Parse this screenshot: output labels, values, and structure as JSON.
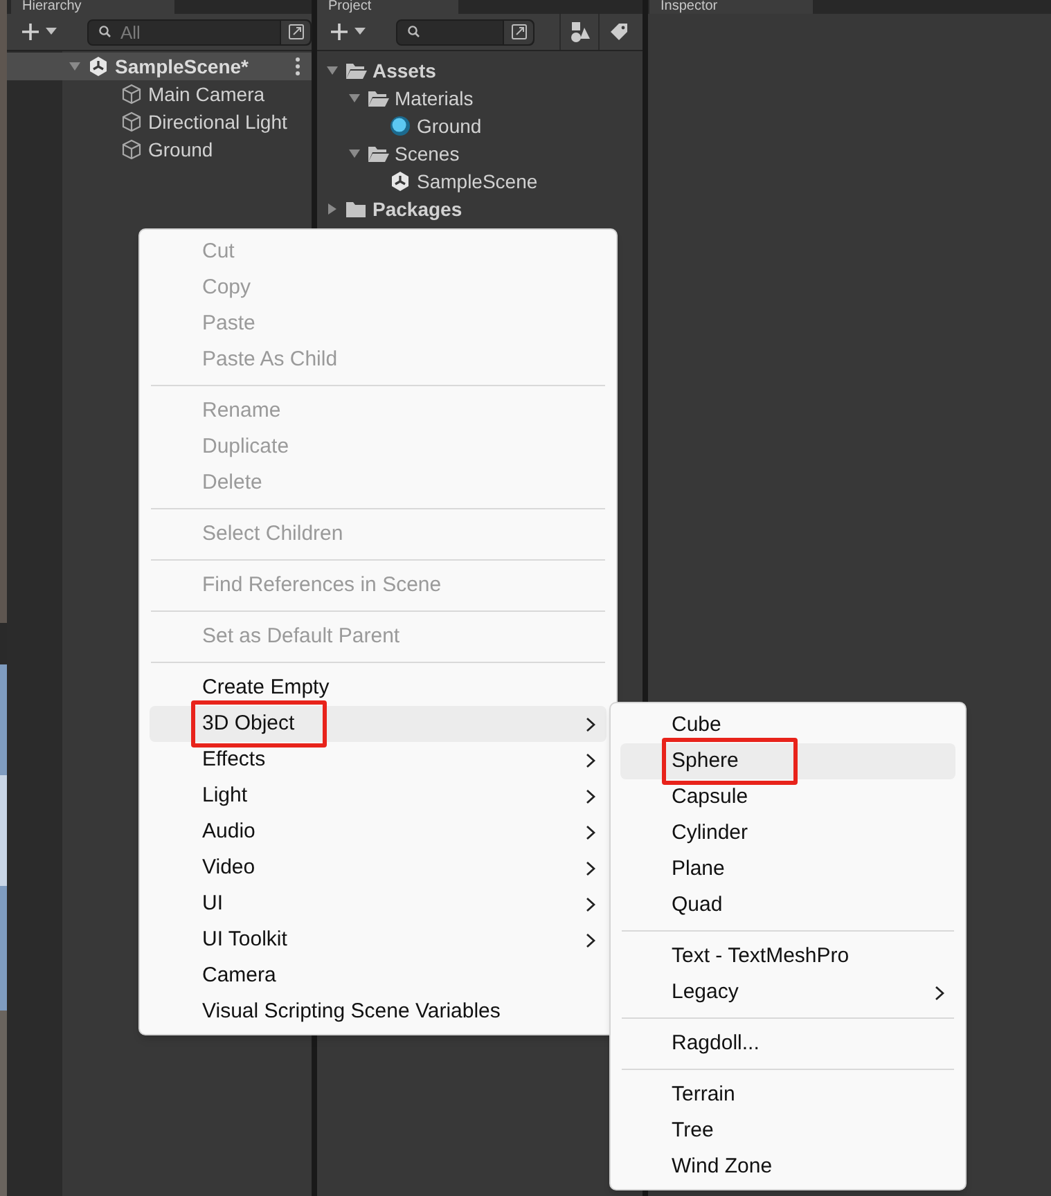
{
  "tabs": [
    {
      "label": "Hierarchy",
      "selected": true
    },
    {
      "label": "Project",
      "selected": true
    },
    {
      "label": "Inspector",
      "selected": true
    }
  ],
  "hierarchy": {
    "search": {
      "placeholder": "All"
    },
    "scene": {
      "label": "SampleScene*",
      "selected": true
    },
    "objects": [
      "Main Camera",
      "Directional Light",
      "Ground"
    ]
  },
  "project": {
    "tree": [
      {
        "label": "Assets",
        "kind": "folder",
        "expanded": true,
        "children": [
          {
            "label": "Materials",
            "kind": "folder",
            "expanded": true,
            "children": [
              {
                "label": "Ground",
                "kind": "material"
              }
            ]
          },
          {
            "label": "Scenes",
            "kind": "folder",
            "expanded": true,
            "children": [
              {
                "label": "SampleScene",
                "kind": "scene"
              }
            ]
          }
        ]
      },
      {
        "label": "Packages",
        "kind": "folder",
        "expanded": false
      }
    ]
  },
  "context_menu": {
    "groups": [
      [
        {
          "label": "Cut",
          "disabled": true,
          "submenu": false,
          "selected": false,
          "boxed": false
        },
        {
          "label": "Copy",
          "disabled": true,
          "submenu": false,
          "selected": false,
          "boxed": false
        },
        {
          "label": "Paste",
          "disabled": true,
          "submenu": false,
          "selected": false,
          "boxed": false
        },
        {
          "label": "Paste As Child",
          "disabled": true,
          "submenu": false,
          "selected": false,
          "boxed": false
        }
      ],
      [
        {
          "label": "Rename",
          "disabled": true,
          "submenu": false,
          "selected": false,
          "boxed": false
        },
        {
          "label": "Duplicate",
          "disabled": true,
          "submenu": false,
          "selected": false,
          "boxed": false
        },
        {
          "label": "Delete",
          "disabled": true,
          "submenu": false,
          "selected": false,
          "boxed": false
        }
      ],
      [
        {
          "label": "Select Children",
          "disabled": true,
          "submenu": false,
          "selected": false,
          "boxed": false
        }
      ],
      [
        {
          "label": "Find References in Scene",
          "disabled": true,
          "submenu": false,
          "selected": false,
          "boxed": false
        }
      ],
      [
        {
          "label": "Set as Default Parent",
          "disabled": true,
          "submenu": false,
          "selected": false,
          "boxed": false
        }
      ],
      [
        {
          "label": "Create Empty",
          "disabled": false,
          "submenu": false,
          "selected": false,
          "boxed": false
        },
        {
          "label": "3D Object",
          "disabled": false,
          "submenu": true,
          "selected": true,
          "boxed": true
        },
        {
          "label": "Effects",
          "disabled": false,
          "submenu": true,
          "selected": false,
          "boxed": false
        },
        {
          "label": "Light",
          "disabled": false,
          "submenu": true,
          "selected": false,
          "boxed": false
        },
        {
          "label": "Audio",
          "disabled": false,
          "submenu": true,
          "selected": false,
          "boxed": false
        },
        {
          "label": "Video",
          "disabled": false,
          "submenu": true,
          "selected": false,
          "boxed": false
        },
        {
          "label": "UI",
          "disabled": false,
          "submenu": true,
          "selected": false,
          "boxed": false
        },
        {
          "label": "UI Toolkit",
          "disabled": false,
          "submenu": true,
          "selected": false,
          "boxed": false
        },
        {
          "label": "Camera",
          "disabled": false,
          "submenu": false,
          "selected": false,
          "boxed": false
        },
        {
          "label": "Visual Scripting Scene Variables",
          "disabled": false,
          "submenu": false,
          "selected": false,
          "boxed": false
        }
      ]
    ]
  },
  "submenu": {
    "groups": [
      [
        {
          "label": "Cube",
          "disabled": false,
          "submenu": false,
          "selected": false,
          "boxed": false
        },
        {
          "label": "Sphere",
          "disabled": false,
          "submenu": false,
          "selected": true,
          "boxed": true
        },
        {
          "label": "Capsule",
          "disabled": false,
          "submenu": false,
          "selected": false,
          "boxed": false
        },
        {
          "label": "Cylinder",
          "disabled": false,
          "submenu": false,
          "selected": false,
          "boxed": false
        },
        {
          "label": "Plane",
          "disabled": false,
          "submenu": false,
          "selected": false,
          "boxed": false
        },
        {
          "label": "Quad",
          "disabled": false,
          "submenu": false,
          "selected": false,
          "boxed": false
        }
      ],
      [
        {
          "label": "Text - TextMeshPro",
          "disabled": false,
          "submenu": false,
          "selected": false,
          "boxed": false
        },
        {
          "label": "Legacy",
          "disabled": false,
          "submenu": true,
          "selected": false,
          "boxed": false
        }
      ],
      [
        {
          "label": "Ragdoll...",
          "disabled": false,
          "submenu": false,
          "selected": false,
          "boxed": false
        }
      ],
      [
        {
          "label": "Terrain",
          "disabled": false,
          "submenu": false,
          "selected": false,
          "boxed": false
        },
        {
          "label": "Tree",
          "disabled": false,
          "submenu": false,
          "selected": false,
          "boxed": false
        },
        {
          "label": "Wind Zone",
          "disabled": false,
          "submenu": false,
          "selected": false,
          "boxed": false
        }
      ]
    ]
  }
}
